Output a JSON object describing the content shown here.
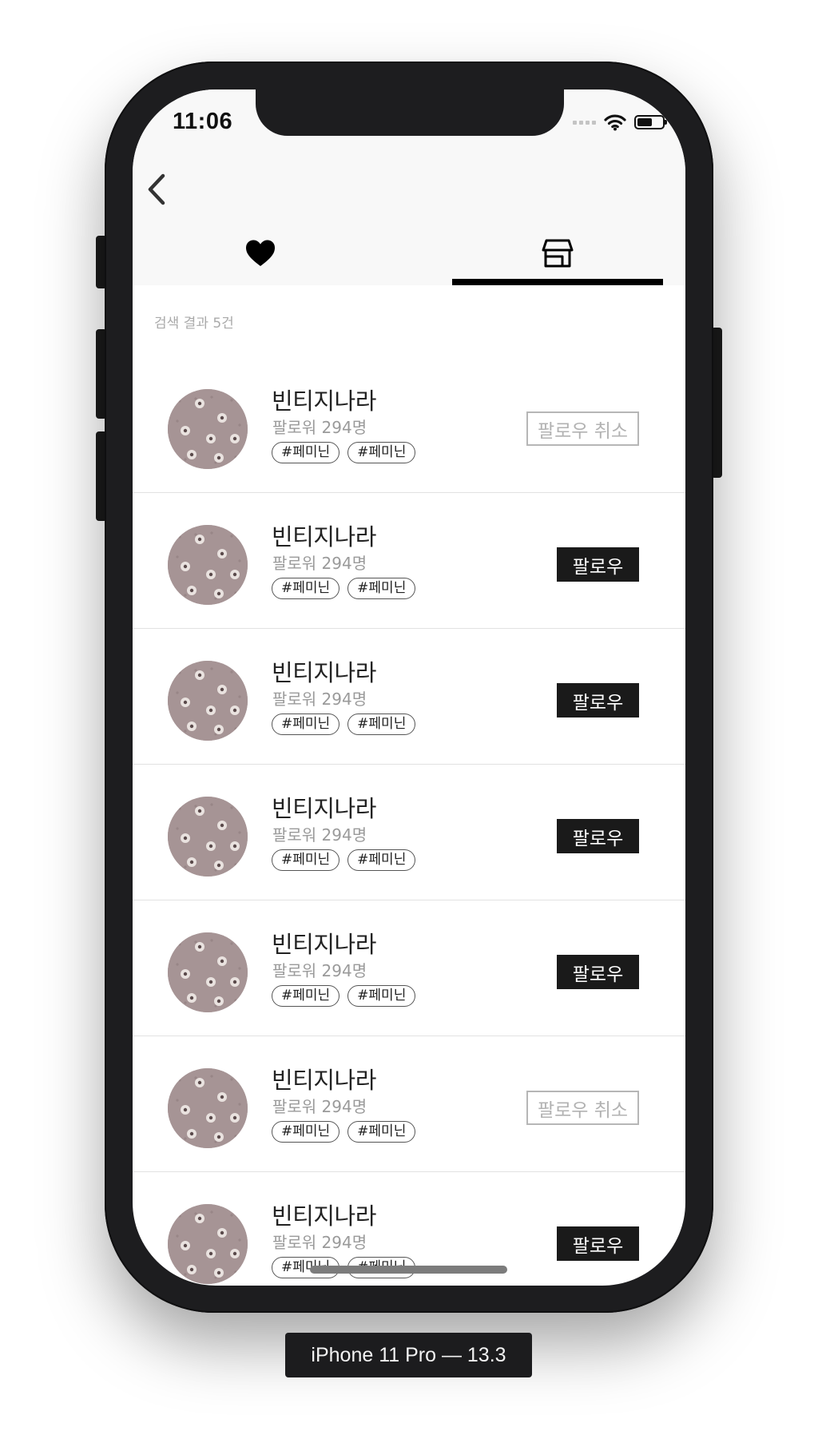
{
  "status_bar": {
    "time": "11:06"
  },
  "tabs": [
    {
      "icon": "heart-icon",
      "selected": false
    },
    {
      "icon": "store-icon",
      "selected": true
    }
  ],
  "result_count": "검색 결과 5건",
  "shops": [
    {
      "name": "빈티지나라",
      "followers": "팔로워 294명",
      "tags": [
        "#페미닌",
        "#페미닌"
      ],
      "follow_label": "팔로우 취소",
      "following": true
    },
    {
      "name": "빈티지나라",
      "followers": "팔로워 294명",
      "tags": [
        "#페미닌",
        "#페미닌"
      ],
      "follow_label": "팔로우",
      "following": false
    },
    {
      "name": "빈티지나라",
      "followers": "팔로워 294명",
      "tags": [
        "#페미닌",
        "#페미닌"
      ],
      "follow_label": "팔로우",
      "following": false
    },
    {
      "name": "빈티지나라",
      "followers": "팔로워 294명",
      "tags": [
        "#페미닌",
        "#페미닌"
      ],
      "follow_label": "팔로우",
      "following": false
    },
    {
      "name": "빈티지나라",
      "followers": "팔로워 294명",
      "tags": [
        "#페미닌",
        "#페미닌"
      ],
      "follow_label": "팔로우",
      "following": false
    },
    {
      "name": "빈티지나라",
      "followers": "팔로워 294명",
      "tags": [
        "#페미닌",
        "#페미닌"
      ],
      "follow_label": "팔로우 취소",
      "following": true
    },
    {
      "name": "빈티지나라",
      "followers": "팔로워 294명",
      "tags": [
        "#페미닌",
        "#페미닌"
      ],
      "follow_label": "팔로우",
      "following": false
    }
  ],
  "device_label": "iPhone 11 Pro — 13.3",
  "colors": {
    "follow_button": "#1a1a1a",
    "unfollow_border": "#b6b6b6",
    "tab_indicator": "#000000",
    "avatar": "#a59394"
  }
}
